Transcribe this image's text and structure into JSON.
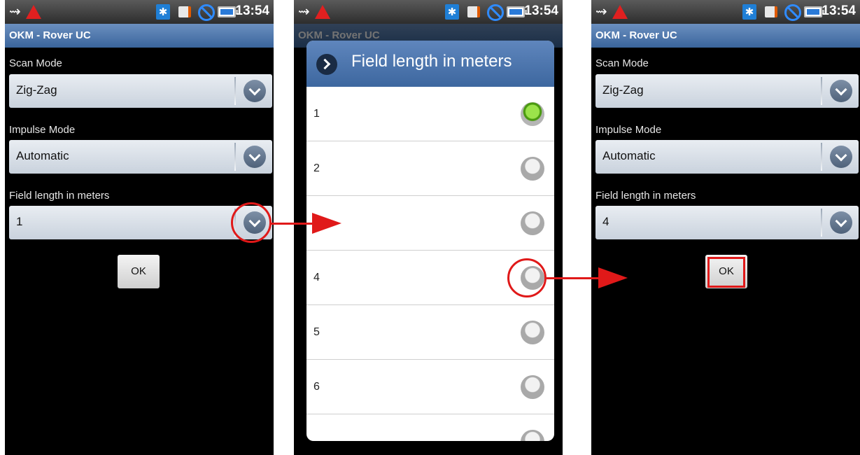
{
  "status_bar": {
    "time": "13:54",
    "usb_icon": "⇝",
    "bluetooth_icon": "✱"
  },
  "app_title": "OKM - Rover UC",
  "screen1": {
    "scan_mode_label": "Scan Mode",
    "scan_mode_value": "Zig-Zag",
    "impulse_mode_label": "Impulse Mode",
    "impulse_mode_value": "Automatic",
    "field_length_label": "Field length in meters",
    "field_length_value": "1",
    "ok_label": "OK"
  },
  "dialog": {
    "title": "Field length in meters",
    "options": [
      {
        "label": "1",
        "selected": true
      },
      {
        "label": "2",
        "selected": false
      },
      {
        "label": "",
        "selected": false
      },
      {
        "label": "4",
        "selected": false
      },
      {
        "label": "5",
        "selected": false
      },
      {
        "label": "6",
        "selected": false
      }
    ]
  },
  "screen3": {
    "scan_mode_label": "Scan Mode",
    "scan_mode_value": "Zig-Zag",
    "impulse_mode_label": "Impulse Mode",
    "impulse_mode_value": "Automatic",
    "field_length_label": "Field length in meters",
    "field_length_value": "4",
    "ok_label": "OK"
  },
  "colors": {
    "title_bar": "#3a659c",
    "annotation": "#e01919",
    "radio_selected": "#7bc62d"
  }
}
